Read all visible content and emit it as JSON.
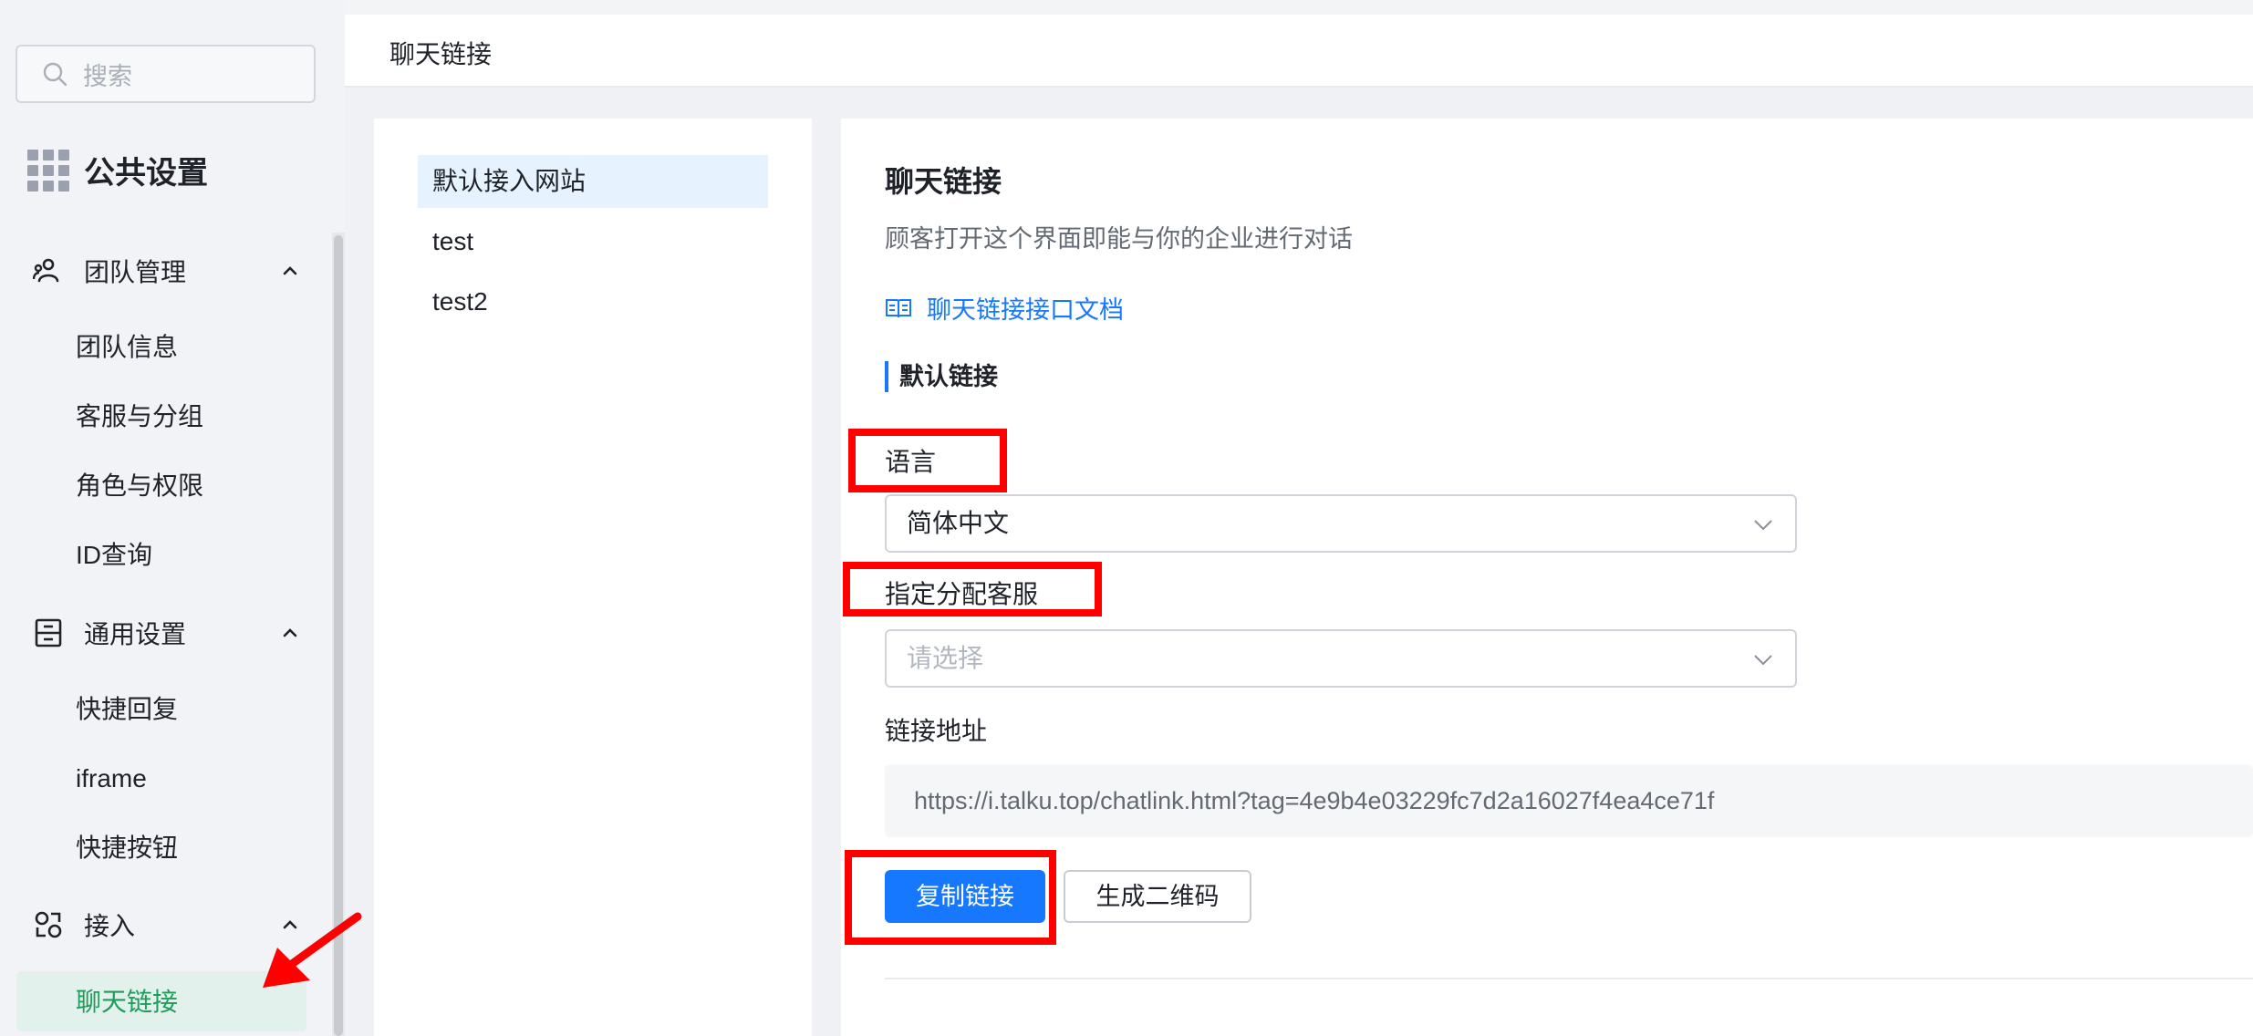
{
  "sidebar": {
    "search_placeholder": "搜索",
    "brand_title": "公共设置",
    "groups": [
      {
        "label": "团队管理",
        "icon": "team-icon",
        "items": [
          "团队信息",
          "客服与分组",
          "角色与权限",
          "ID查询"
        ]
      },
      {
        "label": "通用设置",
        "icon": "settings-icon",
        "items": [
          "快捷回复",
          "iframe",
          "快捷按钮"
        ]
      },
      {
        "label": "接入",
        "icon": "access-icon",
        "items": [
          "聊天链接"
        ]
      }
    ],
    "active_item": "聊天链接"
  },
  "header": {
    "title": "聊天链接"
  },
  "sites": {
    "items": [
      "默认接入网站",
      "test",
      "test2"
    ],
    "selected_index": 0
  },
  "panel": {
    "title": "聊天链接",
    "description": "顾客打开这个界面即能与你的企业进行对话",
    "doc_link": "聊天链接接口文档",
    "section_title": "默认链接",
    "language_label": "语言",
    "language_value": "简体中文",
    "agent_label": "指定分配客服",
    "agent_placeholder": "请选择",
    "url_label": "链接地址",
    "url_value": "https://i.talku.top/chatlink.html?tag=4e9b4e03229fc7d2a16027f4ea4ce71f",
    "copy_button": "复制链接",
    "qrcode_button": "生成二维码"
  },
  "colors": {
    "primary": "#1677ff",
    "active_text": "#1e9c5a",
    "active_bg": "#e3f1ec",
    "highlight": "#ff0000"
  }
}
